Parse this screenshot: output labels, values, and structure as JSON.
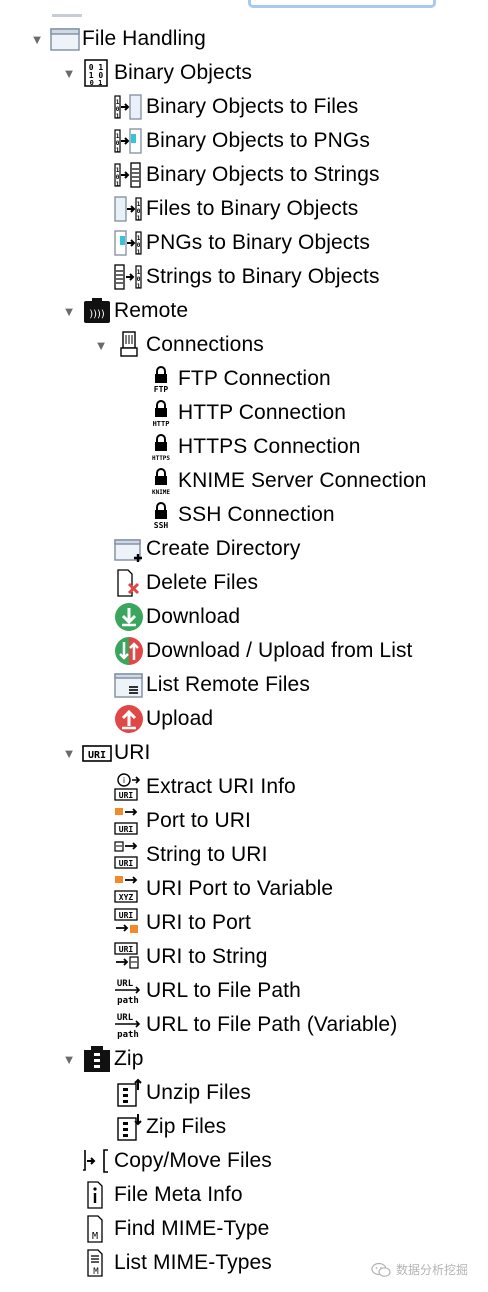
{
  "tree": {
    "file_handling": {
      "label": "File Handling",
      "binary_objects": {
        "label": "Binary Objects",
        "items": [
          "Binary Objects to Files",
          "Binary Objects to PNGs",
          "Binary Objects to Strings",
          "Files to Binary Objects",
          "PNGs to Binary Objects",
          "Strings to Binary Objects"
        ]
      },
      "remote": {
        "label": "Remote",
        "icon_text": "))))",
        "connections": {
          "label": "Connections",
          "items": [
            {
              "label": "FTP Connection",
              "badge": "FTP"
            },
            {
              "label": "HTTP Connection",
              "badge": "HTTP"
            },
            {
              "label": "HTTPS Connection",
              "badge": "HTTPS"
            },
            {
              "label": "KNIME Server Connection",
              "badge": "KNIME"
            },
            {
              "label": "SSH Connection",
              "badge": "SSH"
            }
          ]
        },
        "items": [
          "Create Directory",
          "Delete Files",
          "Download",
          "Download / Upload from List",
          "List Remote Files",
          "Upload"
        ]
      },
      "uri": {
        "label": "URI",
        "icon_text": "URI",
        "items": [
          {
            "label": "Extract URI Info",
            "badge": "URI"
          },
          {
            "label": "Port to URI",
            "badge": "URI"
          },
          {
            "label": "String to URI",
            "badge": "URI"
          },
          {
            "label": "URI Port to Variable",
            "badge": "XYZ"
          },
          {
            "label": "URI to Port",
            "badge": "URI"
          },
          {
            "label": "URI to String",
            "badge": "URI"
          },
          {
            "label": "URL to File Path",
            "badge": "URL",
            "badge2": "path"
          },
          {
            "label": "URL to File Path (Variable)",
            "badge": "URL",
            "badge2": "path"
          }
        ]
      },
      "zip": {
        "label": "Zip",
        "items": [
          "Unzip Files",
          "Zip Files"
        ]
      },
      "items": [
        {
          "label": "Copy/Move Files"
        },
        {
          "label": "File Meta Info",
          "badge": "i"
        },
        {
          "label": "Find MIME-Type",
          "badge": "M"
        },
        {
          "label": "List MIME-Types",
          "badge": "M"
        }
      ]
    }
  },
  "watermark": {
    "text": "数据分析挖掘"
  },
  "icons": [
    "folder-icon",
    "binary-icon",
    "binary-to-files-icon",
    "binary-to-pngs-icon",
    "binary-to-strings-icon",
    "files-to-binary-icon",
    "pngs-to-binary-icon",
    "strings-to-binary-icon",
    "remote-icon",
    "connections-icon",
    "lock-icon",
    "create-directory-icon",
    "delete-files-icon",
    "download-icon",
    "download-upload-icon",
    "list-remote-files-icon",
    "upload-icon",
    "uri-icon",
    "zip-icon",
    "copy-move-icon",
    "file-meta-icon",
    "mime-icon",
    "list-mime-icon"
  ],
  "colors": {
    "green": "#3aa55d",
    "red": "#e04848",
    "orange": "#f08a2c",
    "cyan": "#36c4d8",
    "triangle": "#6b6b6b"
  }
}
